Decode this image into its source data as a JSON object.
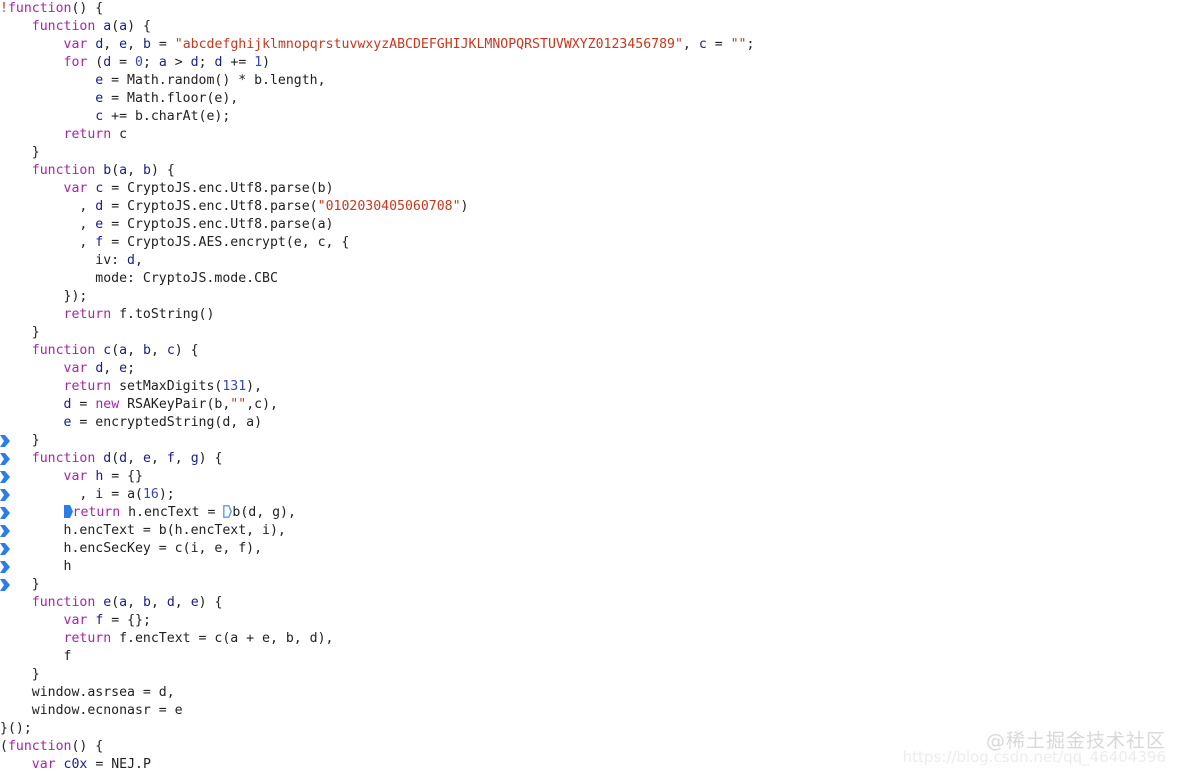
{
  "editor": {
    "language": "javascript",
    "background": "#ffffff",
    "font_size_px": 13.2,
    "line_height_px": 18,
    "colors": {
      "text": "#202124",
      "keyword": "#a626a4",
      "string": "#c5391f",
      "number": "#3a44b5",
      "variable": "#1a1a8c",
      "bang": "#c0392b",
      "gutter_marker": "#2b7de9",
      "inline_marker_fill": "#2b7de9",
      "inline_marker_outline": "#5b9bee"
    },
    "lines": [
      {
        "n": 1,
        "indent": 0,
        "tokens": [
          {
            "t": "!",
            "c": "bang"
          },
          {
            "t": "function",
            "c": "kw"
          },
          {
            "t": "() {",
            "c": "plain"
          }
        ]
      },
      {
        "n": 2,
        "indent": 1,
        "tokens": [
          {
            "t": "function",
            "c": "kw"
          },
          {
            "t": " ",
            "c": "plain"
          },
          {
            "t": "a",
            "c": "var"
          },
          {
            "t": "(",
            "c": "plain"
          },
          {
            "t": "a",
            "c": "var"
          },
          {
            "t": ") {",
            "c": "plain"
          }
        ]
      },
      {
        "n": 3,
        "indent": 2,
        "tokens": [
          {
            "t": "var",
            "c": "kw"
          },
          {
            "t": " ",
            "c": "plain"
          },
          {
            "t": "d",
            "c": "var"
          },
          {
            "t": ", ",
            "c": "plain"
          },
          {
            "t": "e",
            "c": "var"
          },
          {
            "t": ", ",
            "c": "plain"
          },
          {
            "t": "b",
            "c": "var"
          },
          {
            "t": " = ",
            "c": "plain"
          },
          {
            "t": "\"abcdefghijklmnopqrstuvwxyzABCDEFGHIJKLMNOPQRSTUVWXYZ0123456789\"",
            "c": "str"
          },
          {
            "t": ", ",
            "c": "plain"
          },
          {
            "t": "c",
            "c": "var"
          },
          {
            "t": " = ",
            "c": "plain"
          },
          {
            "t": "\"\"",
            "c": "str"
          },
          {
            "t": ";",
            "c": "plain"
          }
        ]
      },
      {
        "n": 4,
        "indent": 2,
        "tokens": [
          {
            "t": "for",
            "c": "kw"
          },
          {
            "t": " (",
            "c": "plain"
          },
          {
            "t": "d",
            "c": "var"
          },
          {
            "t": " = ",
            "c": "plain"
          },
          {
            "t": "0",
            "c": "num"
          },
          {
            "t": "; ",
            "c": "plain"
          },
          {
            "t": "a",
            "c": "var"
          },
          {
            "t": " > ",
            "c": "plain"
          },
          {
            "t": "d",
            "c": "var"
          },
          {
            "t": "; ",
            "c": "plain"
          },
          {
            "t": "d",
            "c": "var"
          },
          {
            "t": " += ",
            "c": "plain"
          },
          {
            "t": "1",
            "c": "num"
          },
          {
            "t": ")",
            "c": "plain"
          }
        ]
      },
      {
        "n": 5,
        "indent": 3,
        "tokens": [
          {
            "t": "e",
            "c": "var"
          },
          {
            "t": " = Math.random() * b.length,",
            "c": "plain"
          }
        ]
      },
      {
        "n": 6,
        "indent": 3,
        "tokens": [
          {
            "t": "e",
            "c": "var"
          },
          {
            "t": " = Math.floor(e),",
            "c": "plain"
          }
        ]
      },
      {
        "n": 7,
        "indent": 3,
        "tokens": [
          {
            "t": "c",
            "c": "var"
          },
          {
            "t": " += b.charAt(e);",
            "c": "plain"
          }
        ]
      },
      {
        "n": 8,
        "indent": 2,
        "tokens": [
          {
            "t": "return",
            "c": "kw"
          },
          {
            "t": " c",
            "c": "plain"
          }
        ]
      },
      {
        "n": 9,
        "indent": 1,
        "tokens": [
          {
            "t": "}",
            "c": "plain"
          }
        ]
      },
      {
        "n": 10,
        "indent": 1,
        "tokens": [
          {
            "t": "function",
            "c": "kw"
          },
          {
            "t": " ",
            "c": "plain"
          },
          {
            "t": "b",
            "c": "var"
          },
          {
            "t": "(",
            "c": "plain"
          },
          {
            "t": "a",
            "c": "var"
          },
          {
            "t": ", ",
            "c": "plain"
          },
          {
            "t": "b",
            "c": "var"
          },
          {
            "t": ") {",
            "c": "plain"
          }
        ]
      },
      {
        "n": 11,
        "indent": 2,
        "tokens": [
          {
            "t": "var",
            "c": "kw"
          },
          {
            "t": " ",
            "c": "plain"
          },
          {
            "t": "c",
            "c": "var"
          },
          {
            "t": " = CryptoJS.enc.Utf8.parse(b)",
            "c": "plain"
          }
        ]
      },
      {
        "n": 12,
        "indent": 2,
        "lead": "  ",
        "tokens": [
          {
            "t": ", ",
            "c": "plain"
          },
          {
            "t": "d",
            "c": "var"
          },
          {
            "t": " = CryptoJS.enc.Utf8.parse(",
            "c": "plain"
          },
          {
            "t": "\"0102030405060708\"",
            "c": "str"
          },
          {
            "t": ")",
            "c": "plain"
          }
        ]
      },
      {
        "n": 13,
        "indent": 2,
        "lead": "  ",
        "tokens": [
          {
            "t": ", ",
            "c": "plain"
          },
          {
            "t": "e",
            "c": "var"
          },
          {
            "t": " = CryptoJS.enc.Utf8.parse(a)",
            "c": "plain"
          }
        ]
      },
      {
        "n": 14,
        "indent": 2,
        "lead": "  ",
        "tokens": [
          {
            "t": ", ",
            "c": "plain"
          },
          {
            "t": "f",
            "c": "var"
          },
          {
            "t": " = CryptoJS.AES.encrypt(e, c, {",
            "c": "plain"
          }
        ]
      },
      {
        "n": 15,
        "indent": 2,
        "lead": "    ",
        "tokens": [
          {
            "t": "iv: ",
            "c": "plain"
          },
          {
            "t": "d",
            "c": "var"
          },
          {
            "t": ",",
            "c": "plain"
          }
        ]
      },
      {
        "n": 16,
        "indent": 2,
        "lead": "    ",
        "tokens": [
          {
            "t": "mode: CryptoJS.mode.CBC",
            "c": "plain"
          }
        ]
      },
      {
        "n": 17,
        "indent": 2,
        "tokens": [
          {
            "t": "});",
            "c": "plain"
          }
        ]
      },
      {
        "n": 18,
        "indent": 2,
        "tokens": [
          {
            "t": "return",
            "c": "kw"
          },
          {
            "t": " f.toString()",
            "c": "plain"
          }
        ]
      },
      {
        "n": 19,
        "indent": 1,
        "tokens": [
          {
            "t": "}",
            "c": "plain"
          }
        ]
      },
      {
        "n": 20,
        "indent": 1,
        "tokens": [
          {
            "t": "function",
            "c": "kw"
          },
          {
            "t": " ",
            "c": "plain"
          },
          {
            "t": "c",
            "c": "var"
          },
          {
            "t": "(",
            "c": "plain"
          },
          {
            "t": "a",
            "c": "var"
          },
          {
            "t": ", ",
            "c": "plain"
          },
          {
            "t": "b",
            "c": "var"
          },
          {
            "t": ", ",
            "c": "plain"
          },
          {
            "t": "c",
            "c": "var"
          },
          {
            "t": ") {",
            "c": "plain"
          }
        ]
      },
      {
        "n": 21,
        "indent": 2,
        "tokens": [
          {
            "t": "var",
            "c": "kw"
          },
          {
            "t": " ",
            "c": "plain"
          },
          {
            "t": "d",
            "c": "var"
          },
          {
            "t": ", ",
            "c": "plain"
          },
          {
            "t": "e",
            "c": "var"
          },
          {
            "t": ";",
            "c": "plain"
          }
        ]
      },
      {
        "n": 22,
        "indent": 2,
        "tokens": [
          {
            "t": "return",
            "c": "kw"
          },
          {
            "t": " setMaxDigits(",
            "c": "plain"
          },
          {
            "t": "131",
            "c": "num"
          },
          {
            "t": "),",
            "c": "plain"
          }
        ]
      },
      {
        "n": 23,
        "indent": 2,
        "tokens": [
          {
            "t": "d",
            "c": "var"
          },
          {
            "t": " = ",
            "c": "plain"
          },
          {
            "t": "new",
            "c": "kw"
          },
          {
            "t": " RSAKeyPair(b,",
            "c": "plain"
          },
          {
            "t": "\"\"",
            "c": "str"
          },
          {
            "t": ",c),",
            "c": "plain"
          }
        ]
      },
      {
        "n": 24,
        "indent": 2,
        "tokens": [
          {
            "t": "e",
            "c": "var"
          },
          {
            "t": " = encryptedString(d, a)",
            "c": "plain"
          }
        ]
      },
      {
        "n": 25,
        "indent": 1,
        "tokens": [
          {
            "t": "}",
            "c": "plain"
          }
        ],
        "gutter": true
      },
      {
        "n": 26,
        "indent": 1,
        "tokens": [
          {
            "t": "function",
            "c": "kw"
          },
          {
            "t": " ",
            "c": "plain"
          },
          {
            "t": "d",
            "c": "var"
          },
          {
            "t": "(",
            "c": "plain"
          },
          {
            "t": "d",
            "c": "var"
          },
          {
            "t": ", ",
            "c": "plain"
          },
          {
            "t": "e",
            "c": "var"
          },
          {
            "t": ", ",
            "c": "plain"
          },
          {
            "t": "f",
            "c": "var"
          },
          {
            "t": ", ",
            "c": "plain"
          },
          {
            "t": "g",
            "c": "var"
          },
          {
            "t": ") {",
            "c": "plain"
          }
        ],
        "gutter": true
      },
      {
        "n": 27,
        "indent": 2,
        "tokens": [
          {
            "t": "var",
            "c": "kw"
          },
          {
            "t": " ",
            "c": "plain"
          },
          {
            "t": "h",
            "c": "var"
          },
          {
            "t": " = {}",
            "c": "plain"
          }
        ],
        "gutter": true
      },
      {
        "n": 28,
        "indent": 2,
        "lead": "  ",
        "tokens": [
          {
            "t": ", ",
            "c": "plain"
          },
          {
            "t": "i",
            "c": "var"
          },
          {
            "t": " = a(",
            "c": "plain"
          },
          {
            "t": "16",
            "c": "num"
          },
          {
            "t": ");",
            "c": "plain"
          }
        ],
        "gutter": true
      },
      {
        "n": 29,
        "indent": 2,
        "tokens": [
          {
            "t": "§FILL§",
            "c": "marker-fill"
          },
          {
            "t": "return",
            "c": "kw"
          },
          {
            "t": " h.encText = ",
            "c": "plain"
          },
          {
            "t": "§OUTLINE§",
            "c": "marker-outline"
          },
          {
            "t": "b(d, g),",
            "c": "plain"
          }
        ],
        "gutter": true
      },
      {
        "n": 30,
        "indent": 2,
        "tokens": [
          {
            "t": "h.encText = b(h.encText, i),",
            "c": "plain"
          }
        ],
        "gutter": true
      },
      {
        "n": 31,
        "indent": 2,
        "tokens": [
          {
            "t": "h.encSecKey = c(i, e, f),",
            "c": "plain"
          }
        ],
        "gutter": true
      },
      {
        "n": 32,
        "indent": 2,
        "tokens": [
          {
            "t": "h",
            "c": "plain"
          }
        ],
        "gutter": true
      },
      {
        "n": 33,
        "indent": 1,
        "tokens": [
          {
            "t": "}",
            "c": "plain"
          }
        ],
        "gutter": true
      },
      {
        "n": 34,
        "indent": 1,
        "tokens": [
          {
            "t": "function",
            "c": "kw"
          },
          {
            "t": " ",
            "c": "plain"
          },
          {
            "t": "e",
            "c": "var"
          },
          {
            "t": "(",
            "c": "plain"
          },
          {
            "t": "a",
            "c": "var"
          },
          {
            "t": ", ",
            "c": "plain"
          },
          {
            "t": "b",
            "c": "var"
          },
          {
            "t": ", ",
            "c": "plain"
          },
          {
            "t": "d",
            "c": "var"
          },
          {
            "t": ", ",
            "c": "plain"
          },
          {
            "t": "e",
            "c": "var"
          },
          {
            "t": ") {",
            "c": "plain"
          }
        ]
      },
      {
        "n": 35,
        "indent": 2,
        "tokens": [
          {
            "t": "var",
            "c": "kw"
          },
          {
            "t": " ",
            "c": "plain"
          },
          {
            "t": "f",
            "c": "var"
          },
          {
            "t": " = {};",
            "c": "plain"
          }
        ]
      },
      {
        "n": 36,
        "indent": 2,
        "tokens": [
          {
            "t": "return",
            "c": "kw"
          },
          {
            "t": " f.encText = c(a + e, b, d),",
            "c": "plain"
          }
        ]
      },
      {
        "n": 37,
        "indent": 2,
        "tokens": [
          {
            "t": "f",
            "c": "plain"
          }
        ]
      },
      {
        "n": 38,
        "indent": 1,
        "tokens": [
          {
            "t": "}",
            "c": "plain"
          }
        ]
      },
      {
        "n": 39,
        "indent": 1,
        "tokens": [
          {
            "t": "window.asrsea = d,",
            "c": "plain"
          }
        ]
      },
      {
        "n": 40,
        "indent": 1,
        "tokens": [
          {
            "t": "window.ecnonasr = e",
            "c": "plain"
          }
        ]
      },
      {
        "n": 41,
        "indent": 0,
        "tokens": [
          {
            "t": "}();",
            "c": "plain"
          }
        ]
      },
      {
        "n": 42,
        "indent": 0,
        "tokens": [
          {
            "t": "(",
            "c": "plain"
          },
          {
            "t": "function",
            "c": "kw"
          },
          {
            "t": "() {",
            "c": "plain"
          }
        ]
      },
      {
        "n": 43,
        "indent": 1,
        "tokens": [
          {
            "t": "var",
            "c": "kw"
          },
          {
            "t": " ",
            "c": "plain"
          },
          {
            "t": "c0x",
            "c": "var"
          },
          {
            "t": " = NEJ.P",
            "c": "plain"
          }
        ]
      }
    ]
  },
  "watermark": {
    "brand": "@稀土掘金技术社区",
    "url": "https://blog.csdn.net/qq_46404396"
  }
}
